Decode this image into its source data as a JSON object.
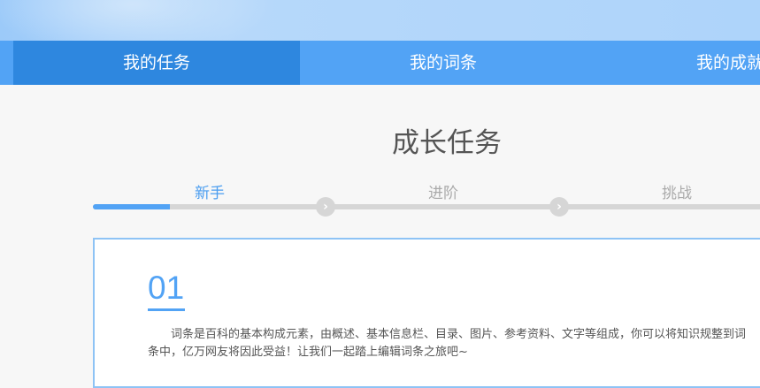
{
  "nav": {
    "tabs": [
      {
        "label": "我的任务",
        "active": true
      },
      {
        "label": "我的词条",
        "active": false
      },
      {
        "label": "我的成就",
        "active": false
      }
    ]
  },
  "main": {
    "title": "成长任务",
    "steps": [
      {
        "label": "新手",
        "active": true
      },
      {
        "label": "进阶",
        "active": false
      },
      {
        "label": "挑战",
        "active": false
      }
    ],
    "progress_percent_of_first_stage": 33,
    "card": {
      "number": "01",
      "description": "词条是百科的基本构成元素，由概述、基本信息栏、目录、图片、参考资料、文字等组成，你可以将知识规整到词条中，亿万网友将因此受益！让我们一起踏上编辑词条之旅吧~"
    }
  },
  "colors": {
    "accent": "#52a3f5",
    "active_tab": "#2e87df"
  }
}
